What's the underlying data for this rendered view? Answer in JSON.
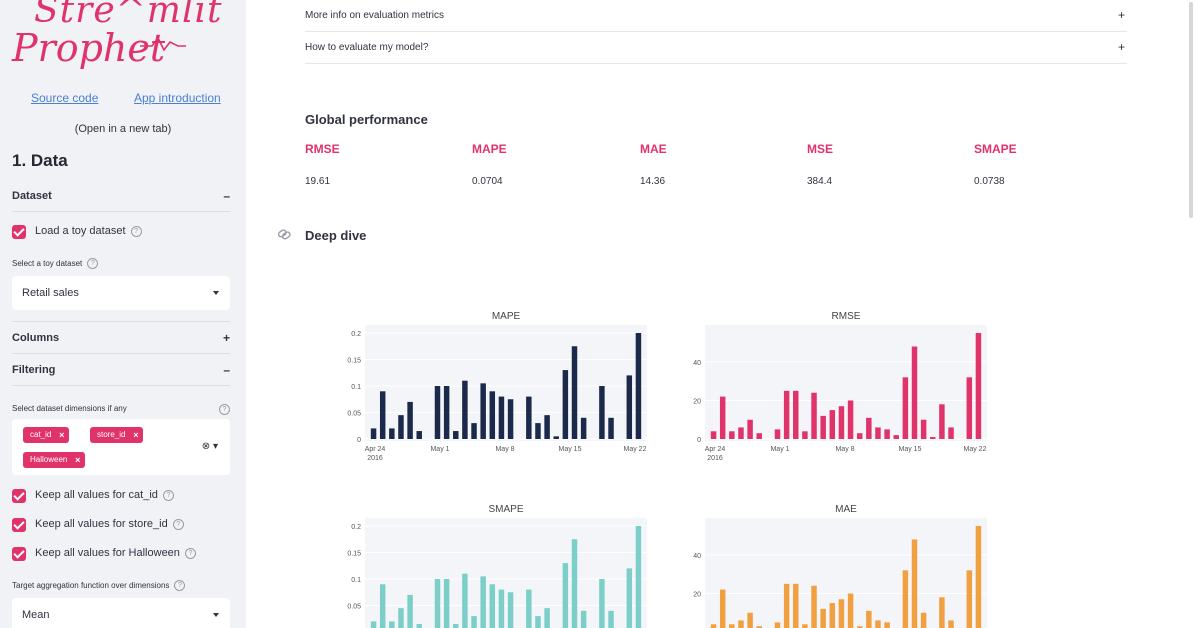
{
  "sidebar": {
    "logo": {
      "line1": "Stre^mlit",
      "line2": "Prophet"
    },
    "links": {
      "source_code": "Source code",
      "app_intro": "App introduction"
    },
    "new_tab_note": "(Open in a new tab)",
    "section_title": "1. Data",
    "dataset": {
      "header": "Dataset",
      "load_toy_label": "Load a toy dataset",
      "select_toy_label": "Select a toy dataset",
      "selected_dataset": "Retail sales"
    },
    "columns_header": "Columns",
    "filtering": {
      "header": "Filtering",
      "dimensions_label": "Select dataset dimensions if any",
      "tags": [
        "cat_id",
        "store_id",
        "Halloween"
      ],
      "keep_cat": "Keep all values for cat_id",
      "keep_store": "Keep all values for store_id",
      "keep_halloween": "Keep all values for Halloween",
      "agg_label": "Target aggregation function over dimensions",
      "agg_value": "Mean"
    },
    "icons": {
      "help": "help-circle-icon",
      "collapse": "minus-icon",
      "expand": "plus-icon",
      "caret": "chevron-down-icon",
      "clear": "close-icon"
    }
  },
  "main": {
    "expanders": [
      {
        "label": "More info on evaluation metrics",
        "sign": "+"
      },
      {
        "label": "How to evaluate my model?",
        "sign": "+"
      }
    ],
    "global_performance": {
      "title": "Global performance",
      "metrics": [
        {
          "name": "RMSE",
          "value": "19.61"
        },
        {
          "name": "MAPE",
          "value": "0.0704"
        },
        {
          "name": "MAE",
          "value": "14.36"
        },
        {
          "name": "MSE",
          "value": "384.4"
        },
        {
          "name": "SMAPE",
          "value": "0.0738"
        }
      ]
    },
    "deep_dive_title": "Deep dive",
    "accent_color": "#e0336a"
  },
  "chart_data": [
    {
      "type": "bar",
      "title": "MAPE",
      "color": "#1b2a4a",
      "x_ticks": [
        "Apr 24\n2016",
        "May 1",
        "May 8",
        "May 15",
        "May 22"
      ],
      "y_ticks": [
        "0",
        "0.05",
        "0.1",
        "0.15",
        "0.2"
      ],
      "ylim": [
        0,
        0.2
      ],
      "values": [
        0.02,
        0.09,
        0.02,
        0.045,
        0.07,
        0.015,
        0,
        0.1,
        0.1,
        0.015,
        0.11,
        0.03,
        0.105,
        0.09,
        0.08,
        0.075,
        0,
        0.08,
        0.03,
        0.045,
        0.005,
        0.13,
        0.175,
        0.04,
        0,
        0.1,
        0.04,
        0,
        0.12,
        0.2
      ]
    },
    {
      "type": "bar",
      "title": "RMSE",
      "color": "#e0336a",
      "x_ticks": [
        "Apr 24\n2016",
        "May 1",
        "May 8",
        "May 15",
        "May 22"
      ],
      "y_ticks": [
        "0",
        "20",
        "40"
      ],
      "ylim": [
        0,
        55
      ],
      "values": [
        4,
        22,
        4,
        6,
        10,
        3,
        0,
        5,
        25,
        25,
        4,
        24,
        12,
        15,
        17,
        20,
        3,
        11,
        6,
        5,
        2,
        32,
        48,
        10,
        1,
        18,
        6,
        0,
        32,
        55
      ]
    },
    {
      "type": "bar",
      "title": "SMAPE",
      "color": "#7ccfc9",
      "x_ticks": [],
      "y_ticks": [
        "0.05",
        "0.1",
        "0.15",
        "0.2"
      ],
      "ylim": [
        0,
        0.2
      ],
      "values": [
        0.02,
        0.09,
        0.02,
        0.045,
        0.07,
        0.015,
        0,
        0.1,
        0.1,
        0.015,
        0.11,
        0.03,
        0.105,
        0.09,
        0.08,
        0.075,
        0,
        0.08,
        0.03,
        0.045,
        0.005,
        0.13,
        0.175,
        0.04,
        0,
        0.1,
        0.04,
        0,
        0.12,
        0.2
      ]
    },
    {
      "type": "bar",
      "title": "MAE",
      "color": "#f0a040",
      "x_ticks": [],
      "y_ticks": [
        "20",
        "40"
      ],
      "ylim": [
        0,
        55
      ],
      "values": [
        4,
        22,
        4,
        6,
        10,
        3,
        0,
        5,
        25,
        25,
        4,
        24,
        12,
        15,
        17,
        20,
        3,
        11,
        6,
        5,
        2,
        32,
        48,
        10,
        1,
        18,
        6,
        0,
        32,
        55
      ]
    }
  ]
}
